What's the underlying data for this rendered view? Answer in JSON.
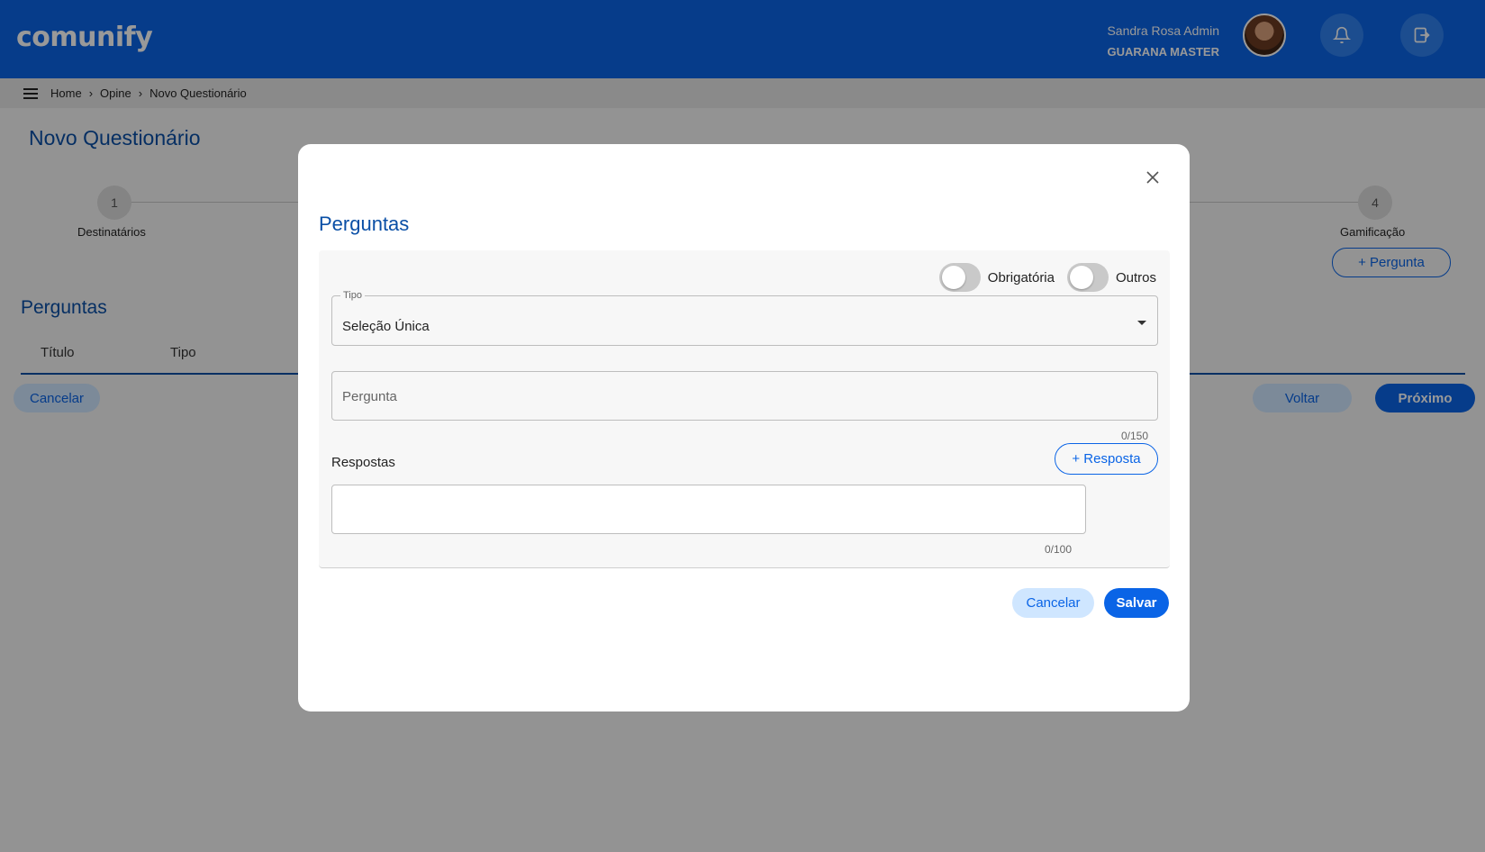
{
  "header": {
    "logo": "comunify",
    "user_name": "Sandra Rosa Admin",
    "organization": "GUARANA MASTER"
  },
  "breadcrumb": [
    "Home",
    "Opine",
    "Novo Questionário"
  ],
  "page": {
    "title": "Novo Questionário",
    "steps": [
      {
        "number": "1",
        "label": "Destinatários"
      },
      {
        "number": "4",
        "label": "Gamificação"
      }
    ],
    "add_question": "+ Pergunta",
    "section_title": "Perguntas",
    "columns": [
      "Título",
      "Tipo"
    ],
    "cancel": "Cancelar",
    "back": "Voltar",
    "next": "Próximo"
  },
  "modal": {
    "title": "Perguntas",
    "toggle_required": "Obrigatória",
    "toggle_others": "Outros",
    "type_label": "Tipo",
    "type_value": "Seleção Única",
    "question_placeholder": "Pergunta",
    "question_counter": "0/150",
    "answers_label": "Respostas",
    "add_answer": "+ Resposta",
    "answer_counter": "0/100",
    "cancel": "Cancelar",
    "save": "Salvar"
  },
  "colors": {
    "primary": "#0a64e6",
    "title_blue": "#0a4fa6"
  }
}
